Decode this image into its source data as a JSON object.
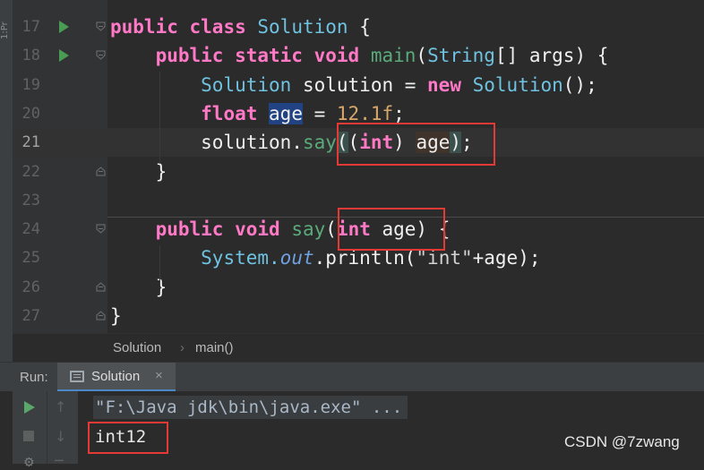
{
  "side_panel": {
    "label": "1:Pr"
  },
  "editor": {
    "lines": [
      {
        "num": "17",
        "run_marker": true,
        "fold": "open",
        "current": false,
        "tokens": [
          {
            "t": "public",
            "c": "kw"
          },
          {
            "t": " "
          },
          {
            "t": "class",
            "c": "kw"
          },
          {
            "t": " "
          },
          {
            "t": "Solution",
            "c": "cls"
          },
          {
            "t": " {",
            "c": "plain"
          }
        ]
      },
      {
        "num": "18",
        "run_marker": true,
        "fold": "open",
        "current": false,
        "tokens": [
          {
            "t": "    "
          },
          {
            "t": "public",
            "c": "kw"
          },
          {
            "t": " "
          },
          {
            "t": "static",
            "c": "kw"
          },
          {
            "t": " "
          },
          {
            "t": "void",
            "c": "kw"
          },
          {
            "t": " "
          },
          {
            "t": "main",
            "c": "meth"
          },
          {
            "t": "(",
            "c": "plain"
          },
          {
            "t": "String",
            "c": "cls"
          },
          {
            "t": "[] args) {",
            "c": "plain"
          }
        ]
      },
      {
        "num": "19",
        "run_marker": false,
        "fold": "",
        "current": false,
        "tokens": [
          {
            "t": "        "
          },
          {
            "t": "Solution",
            "c": "cls"
          },
          {
            "t": " solution = ",
            "c": "plain"
          },
          {
            "t": "new",
            "c": "kw"
          },
          {
            "t": " "
          },
          {
            "t": "Solution",
            "c": "cls"
          },
          {
            "t": "();",
            "c": "plain"
          }
        ]
      },
      {
        "num": "20",
        "run_marker": false,
        "fold": "",
        "current": false,
        "tokens": [
          {
            "t": "        "
          },
          {
            "t": "float",
            "c": "kw"
          },
          {
            "t": " "
          },
          {
            "t": "age",
            "c": "plain hl-sel"
          },
          {
            "t": " = ",
            "c": "plain"
          },
          {
            "t": "12.1f",
            "c": "num"
          },
          {
            "t": ";",
            "c": "plain"
          }
        ]
      },
      {
        "num": "21",
        "run_marker": false,
        "fold": "",
        "current": true,
        "tokens": [
          {
            "t": "        "
          },
          {
            "t": "solution.",
            "c": "plain"
          },
          {
            "t": "say",
            "c": "meth"
          },
          {
            "t": "(",
            "c": "plain hl-brace"
          },
          {
            "t": "(",
            "c": "plain"
          },
          {
            "t": "int",
            "c": "kw"
          },
          {
            "t": ") ",
            "c": "plain"
          },
          {
            "t": "age",
            "c": "plain hl-usage"
          },
          {
            "t": ")",
            "c": "plain hl-brace"
          },
          {
            "t": ";",
            "c": "plain"
          }
        ]
      },
      {
        "num": "22",
        "run_marker": false,
        "fold": "close",
        "current": false,
        "tokens": [
          {
            "t": "    "
          },
          {
            "t": "}",
            "c": "plain"
          }
        ]
      },
      {
        "num": "23",
        "run_marker": false,
        "fold": "",
        "current": false,
        "tokens": []
      },
      {
        "num": "24",
        "run_marker": false,
        "fold": "open",
        "current": false,
        "tokens": [
          {
            "t": "    "
          },
          {
            "t": "public",
            "c": "kw"
          },
          {
            "t": " "
          },
          {
            "t": "void",
            "c": "kw"
          },
          {
            "t": " "
          },
          {
            "t": "say",
            "c": "meth"
          },
          {
            "t": "(",
            "c": "plain"
          },
          {
            "t": "int",
            "c": "kw"
          },
          {
            "t": " age) {",
            "c": "plain"
          }
        ]
      },
      {
        "num": "25",
        "run_marker": false,
        "fold": "",
        "current": false,
        "tokens": [
          {
            "t": "        "
          },
          {
            "t": "System.",
            "c": "cls"
          },
          {
            "t": "out",
            "c": "fld"
          },
          {
            "t": ".println(",
            "c": "plain"
          },
          {
            "t": "\"int\"",
            "c": "str"
          },
          {
            "t": "+age);",
            "c": "plain"
          }
        ]
      },
      {
        "num": "26",
        "run_marker": false,
        "fold": "close",
        "current": false,
        "tokens": [
          {
            "t": "    "
          },
          {
            "t": "}",
            "c": "plain"
          }
        ]
      },
      {
        "num": "27",
        "run_marker": false,
        "fold": "close",
        "current": false,
        "tokens": [
          {
            "t": "}",
            "c": "plain"
          }
        ]
      }
    ]
  },
  "breadcrumb": {
    "items": [
      "Solution",
      "main()"
    ],
    "separator": "›"
  },
  "run_panel": {
    "label": "Run:",
    "tab_label": "Solution",
    "tab_close": "×"
  },
  "console": {
    "command_line": "\"F:\\Java jdk\\bin\\java.exe\" ...",
    "output_line": "int12"
  },
  "watermark": "CSDN @7zwang"
}
